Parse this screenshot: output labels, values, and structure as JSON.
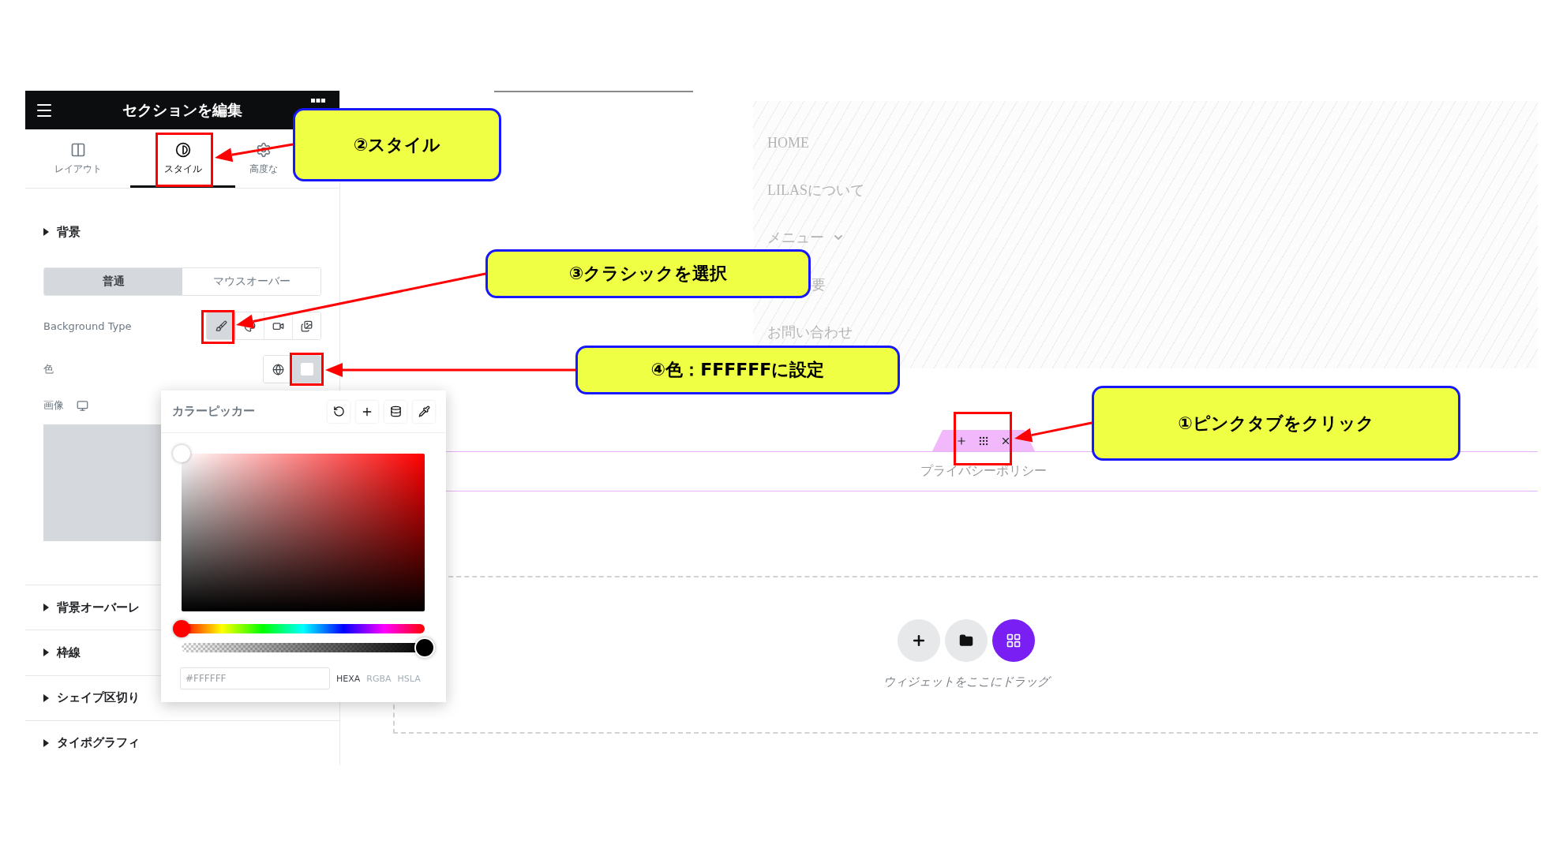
{
  "panel": {
    "title": "セクションを編集",
    "tabs": [
      {
        "label": "レイアウト",
        "kind": "layout",
        "selected": false
      },
      {
        "label": "スタイル",
        "kind": "style",
        "selected": true
      },
      {
        "label": "高度な",
        "kind": "advanced",
        "selected": false
      }
    ],
    "background": {
      "title": "背景",
      "state_tabs": [
        {
          "label": "普通",
          "selected": true
        },
        {
          "label": "マウスオーバー",
          "selected": false
        }
      ],
      "type_label": "Background Type",
      "type_options": [
        {
          "kind": "classic",
          "selected": true
        },
        {
          "kind": "gradient",
          "selected": false
        },
        {
          "kind": "video",
          "selected": false
        },
        {
          "kind": "slideshow",
          "selected": false
        }
      ],
      "color_label": "色",
      "image_label": "画像"
    },
    "sections": [
      {
        "title": "背景オーバーレ"
      },
      {
        "title": "枠線"
      },
      {
        "title": "シェイプ区切り"
      },
      {
        "title": "タイポグラフィ"
      }
    ]
  },
  "color_picker": {
    "title": "カラーピッカー",
    "hue_slider": {
      "level": 0
    },
    "alpha_slider": {
      "level": 1
    },
    "placeholder": "#FFFFFF",
    "formats": [
      {
        "label": "HEXA",
        "selected": true
      },
      {
        "label": "RGBA",
        "selected": false
      },
      {
        "label": "HSLA",
        "selected": false
      }
    ]
  },
  "canvas": {
    "nav_items": [
      {
        "label": "HOME",
        "dropdown": false,
        "covered": false
      },
      {
        "label": "LILASについて",
        "dropdown": false,
        "covered": false
      },
      {
        "label": "メニュー",
        "dropdown": true,
        "covered": false
      },
      {
        "label": "要",
        "dropdown": false,
        "covered": true
      },
      {
        "label": "お問い合わせ",
        "dropdown": false,
        "covered": false
      }
    ],
    "section_label": "プライバシーポリシー",
    "dropzone_text": "ウィジェットをここにドラッグ"
  },
  "callouts": [
    {
      "text": "②スタイル"
    },
    {
      "text": "③クラシックを選択"
    },
    {
      "text": "④色：FFFFFFに設定"
    },
    {
      "text": "①ピンクタブをクリック"
    }
  ]
}
